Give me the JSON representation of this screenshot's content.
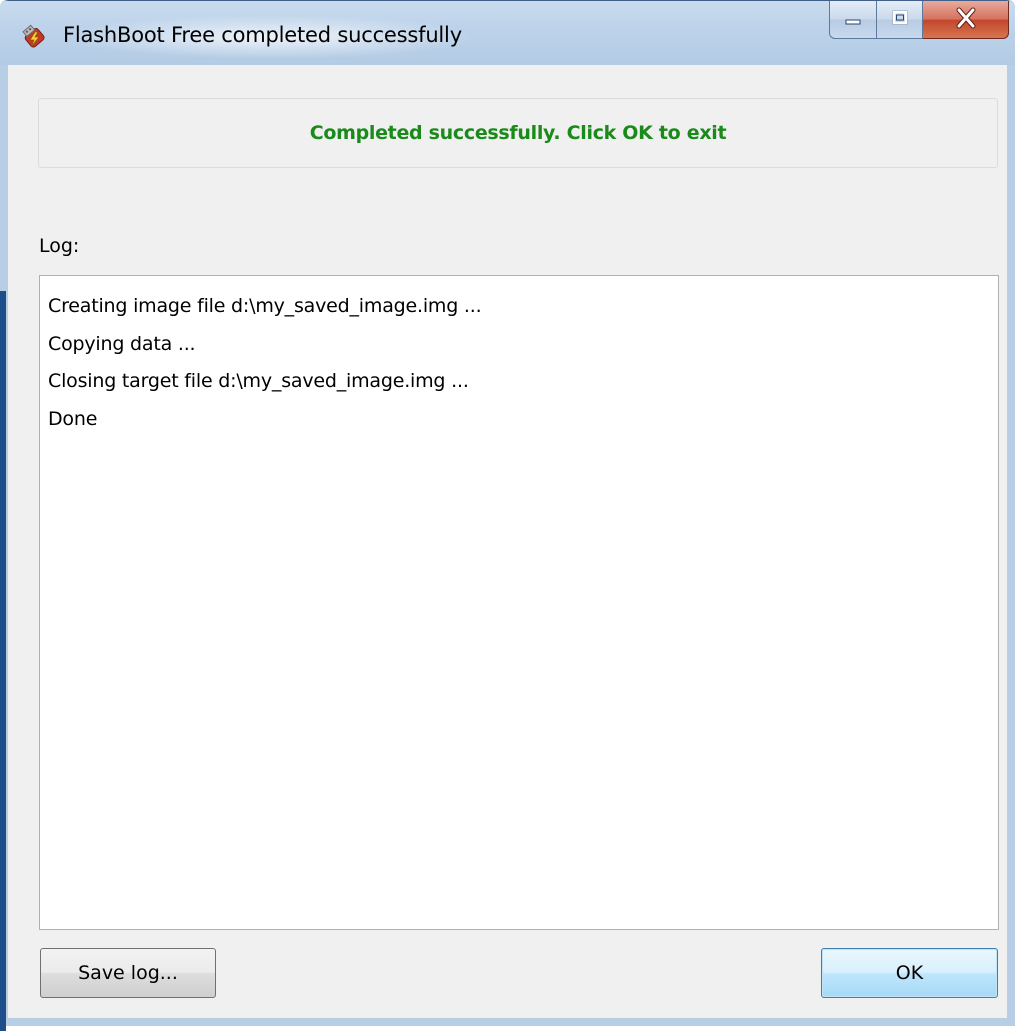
{
  "window": {
    "title": "FlashBoot Free completed successfully",
    "app_icon": "usb-flash-icon"
  },
  "caption_buttons": {
    "minimize": "minimize-icon",
    "maximize": "maximize-icon",
    "close": "close-icon"
  },
  "status": {
    "message": "Completed successfully. Click OK to exit",
    "color": "#1a8a1a"
  },
  "log": {
    "label": "Log:",
    "lines": [
      "Creating image file d:\\my_saved_image.img ...",
      "Copying data ...",
      "Closing target file d:\\my_saved_image.img ...",
      "Done"
    ]
  },
  "buttons": {
    "save_log": "Save log...",
    "ok": "OK"
  }
}
